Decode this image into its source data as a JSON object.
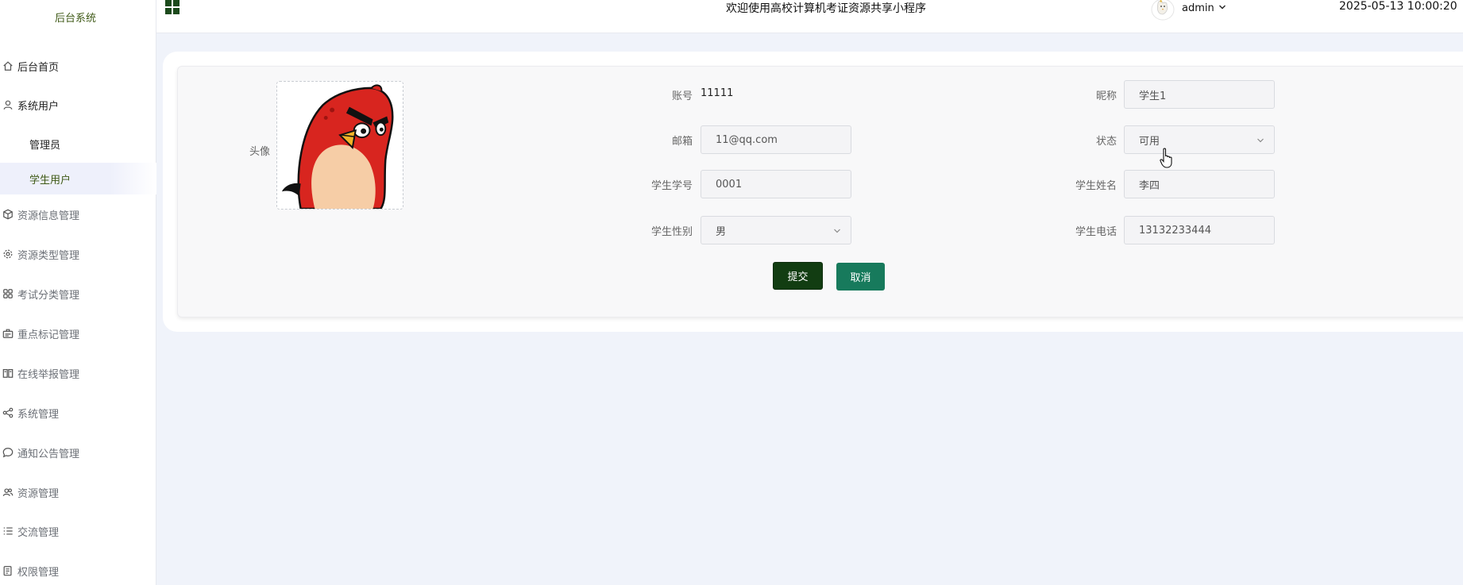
{
  "sidebar": {
    "brand": "后台系统",
    "menu": [
      {
        "label": "后台首页",
        "icon": "home-icon"
      },
      {
        "label": "系统用户",
        "icon": "user-icon"
      },
      {
        "label": "资源信息管理",
        "icon": "cube-icon"
      },
      {
        "label": "资源类型管理",
        "icon": "gear-icon"
      },
      {
        "label": "考试分类管理",
        "icon": "grid-icon"
      },
      {
        "label": "重点标记管理",
        "icon": "badge-icon"
      },
      {
        "label": "在线举报管理",
        "icon": "book-icon"
      },
      {
        "label": "系统管理",
        "icon": "share-icon"
      },
      {
        "label": "通知公告管理",
        "icon": "chat-icon"
      },
      {
        "label": "资源管理",
        "icon": "users-icon"
      },
      {
        "label": "交流管理",
        "icon": "list-icon"
      },
      {
        "label": "权限管理",
        "icon": "clipboard-icon"
      }
    ],
    "sub_items": [
      {
        "label": "管理员"
      },
      {
        "label": "学生用户"
      }
    ]
  },
  "topbar": {
    "title": "欢迎使用高校计算机考证资源共享小程序",
    "username": "admin",
    "datetime": "2025-05-13 10:00:20"
  },
  "form": {
    "avatar_label": "头像",
    "account_label": "账号",
    "account_value": "11111",
    "nickname_label": "昵称",
    "nickname_value": "学生1",
    "email_label": "邮箱",
    "email_value": "11@qq.com",
    "status_label": "状态",
    "status_value": "可用",
    "student_no_label": "学生学号",
    "student_no_value": "0001",
    "student_name_label": "学生姓名",
    "student_name_value": "李四",
    "gender_label": "学生性别",
    "gender_value": "男",
    "phone_label": "学生电话",
    "phone_value": "13132233444",
    "submit_label": "提交",
    "cancel_label": "取消"
  },
  "colors": {
    "accent_dark": "#123d12",
    "accent_teal": "#177a5c",
    "brand_text": "#3f5a17",
    "page_bg": "#f0f3fa"
  }
}
